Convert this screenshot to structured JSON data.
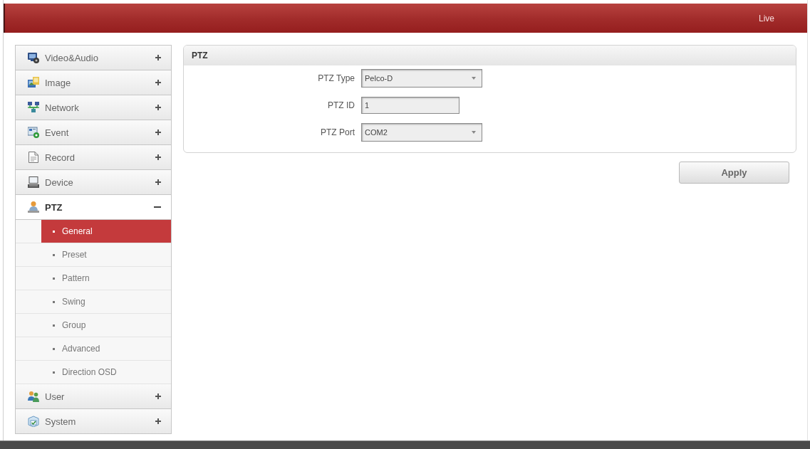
{
  "top_bar": {
    "live_link": "Live"
  },
  "sidebar": {
    "items": [
      {
        "label": "Video&Audio",
        "expanded": false
      },
      {
        "label": "Image",
        "expanded": false
      },
      {
        "label": "Network",
        "expanded": false
      },
      {
        "label": "Event",
        "expanded": false
      },
      {
        "label": "Record",
        "expanded": false
      },
      {
        "label": "Device",
        "expanded": false
      },
      {
        "label": "PTZ",
        "expanded": true,
        "children": [
          {
            "label": "General",
            "selected": true
          },
          {
            "label": "Preset",
            "selected": false
          },
          {
            "label": "Pattern",
            "selected": false
          },
          {
            "label": "Swing",
            "selected": false
          },
          {
            "label": "Group",
            "selected": false
          },
          {
            "label": "Advanced",
            "selected": false
          },
          {
            "label": "Direction OSD",
            "selected": false
          }
        ]
      },
      {
        "label": "User",
        "expanded": false
      },
      {
        "label": "System",
        "expanded": false
      }
    ]
  },
  "panel": {
    "title": "PTZ",
    "fields": [
      {
        "kind": "select",
        "label": "PTZ Type",
        "value": "Pelco-D"
      },
      {
        "kind": "text",
        "label": "PTZ ID",
        "value": "1"
      },
      {
        "kind": "select",
        "label": "PTZ Port",
        "value": "COM2"
      }
    ]
  },
  "apply_button": "Apply"
}
